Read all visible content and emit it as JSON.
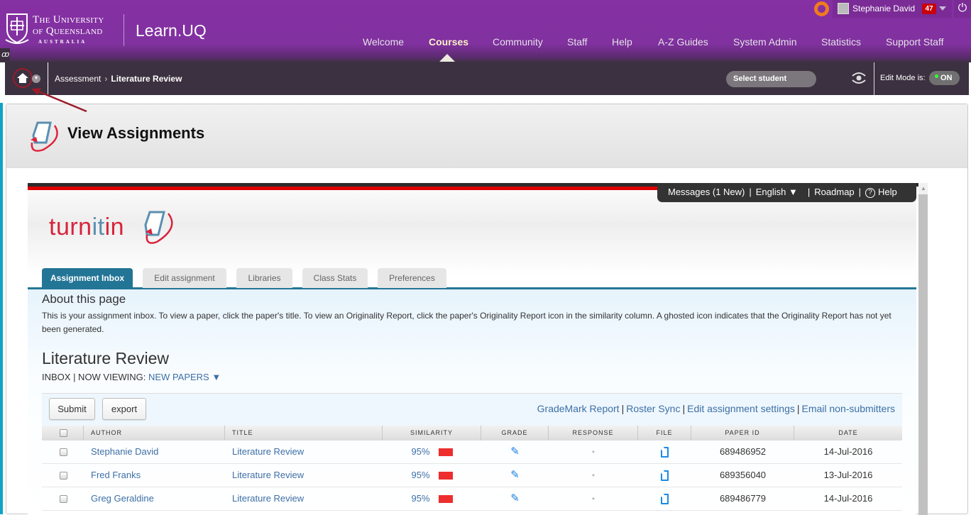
{
  "header": {
    "university_line1": "The University",
    "university_line2": "of Queensland",
    "university_line3": "AUSTRALIA",
    "app_title": "Learn.UQ",
    "nav": [
      {
        "label": "Welcome",
        "active": false
      },
      {
        "label": "Courses",
        "active": true
      },
      {
        "label": "Community",
        "active": false
      },
      {
        "label": "Staff",
        "active": false
      },
      {
        "label": "Help",
        "active": false
      },
      {
        "label": "A-Z Guides",
        "active": false
      },
      {
        "label": "System Admin",
        "active": false
      },
      {
        "label": "Statistics",
        "active": false
      },
      {
        "label": "Support Staff",
        "active": false
      }
    ],
    "user": {
      "name": "Stephanie David",
      "notification_count": "47"
    },
    "icons": {
      "help": "life-ring-icon",
      "power": "power-icon",
      "link": "chain-icon"
    }
  },
  "breadcrumb": {
    "items": [
      "Assessment",
      "Literature Review"
    ],
    "select_student": "Select student",
    "edit_mode_label": "Edit Mode is:",
    "edit_mode_value": "ON"
  },
  "page": {
    "title": "View Assignments"
  },
  "turnitin": {
    "logo_text_red": "turn",
    "logo_text_blue": "it",
    "logo_text_red2": "in",
    "util_bar": {
      "messages": "Messages (1 New)",
      "language": "English ▼",
      "roadmap": "Roadmap",
      "help": "Help",
      "help_glyph": "?"
    },
    "tabs": [
      {
        "label": "Assignment Inbox",
        "active": true
      },
      {
        "label": "Edit assignment",
        "active": false
      },
      {
        "label": "Libraries",
        "active": false
      },
      {
        "label": "Class Stats",
        "active": false
      },
      {
        "label": "Preferences",
        "active": false
      }
    ],
    "about_title": "About this page",
    "about_text": "This is your assignment inbox. To view a paper, click the paper's title. To view an Originality Report, click the paper's Originality Report icon in the similarity column. A ghosted icon indicates that the Originality Report has not yet been generated.",
    "assignment_title": "Literature Review",
    "viewing_prefix": "INBOX | NOW VIEWING: ",
    "viewing_value": "NEW PAPERS ▼",
    "buttons": {
      "submit": "Submit",
      "export": "export"
    },
    "toolbar_links": [
      "GradeMark Report",
      "Roster Sync",
      "Edit assignment settings",
      "Email non-submitters"
    ],
    "columns": [
      "AUTHOR",
      "TITLE",
      "SIMILARITY",
      "GRADE",
      "RESPONSE",
      "FILE",
      "PAPER ID",
      "DATE"
    ],
    "rows": [
      {
        "author": "Stephanie David",
        "title": "Literature Review",
        "similarity": "95%",
        "response": "•",
        "paper_id": "689486952",
        "date": "14-Jul-2016"
      },
      {
        "author": "Fred Franks",
        "title": "Literature Review",
        "similarity": "95%",
        "response": "•",
        "paper_id": "689356040",
        "date": "13-Jul-2016"
      },
      {
        "author": "Greg Geraldine",
        "title": "Literature Review",
        "similarity": "95%",
        "response": "•",
        "paper_id": "689486779",
        "date": "14-Jul-2016"
      }
    ],
    "similarity_color": "#ee2d2d",
    "accent_color": "#237596"
  }
}
